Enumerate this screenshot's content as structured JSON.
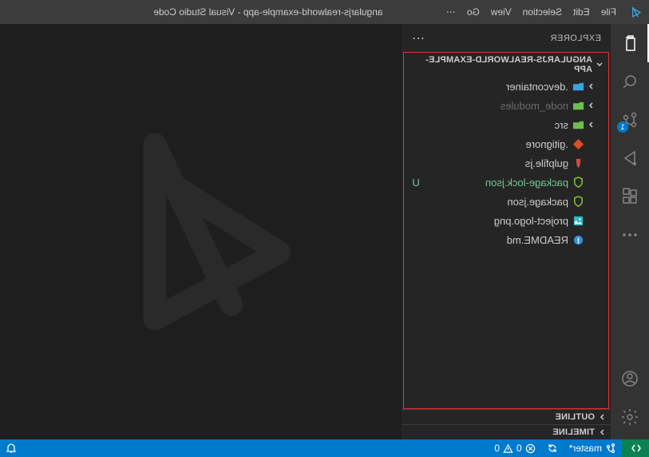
{
  "titlebar": {
    "menu": [
      "File",
      "Edit",
      "Selection",
      "View",
      "Go"
    ],
    "menu_overflow": "⋯",
    "title": "angularjs-realworld-example-app - Visual Studio Code"
  },
  "activity_badge": "1",
  "sidebar": {
    "header": "EXPLORER",
    "header_more": "⋯",
    "root": "ANGULARJS-REALWORLD-EXAMPLE-APP",
    "items": [
      {
        "kind": "folder",
        "label": ".devcontainer",
        "color": "#3ba2e0"
      },
      {
        "kind": "folder",
        "label": "node_modules",
        "color": "#6cc04a",
        "dim": true
      },
      {
        "kind": "folder",
        "label": "src",
        "color": "#6cc04a"
      },
      {
        "kind": "file",
        "label": ".gitignore",
        "iconColor": "#e04e26"
      },
      {
        "kind": "file",
        "label": "gulpfile.js",
        "iconColor": "#d44b3d"
      },
      {
        "kind": "file",
        "label": "package-lock.json",
        "iconColor": "#8bbf3f",
        "status": "U"
      },
      {
        "kind": "file",
        "label": "package.json",
        "iconColor": "#8bbf3f"
      },
      {
        "kind": "file",
        "label": "project-logo.png",
        "iconColor": "#2fb8c5"
      },
      {
        "kind": "file",
        "label": "README.md",
        "iconColor": "#2f8fe0"
      }
    ],
    "outline": "OUTLINE",
    "timeline": "TIMELINE"
  },
  "statusbar": {
    "branch": "master*",
    "errors": "0",
    "warnings": "0"
  }
}
